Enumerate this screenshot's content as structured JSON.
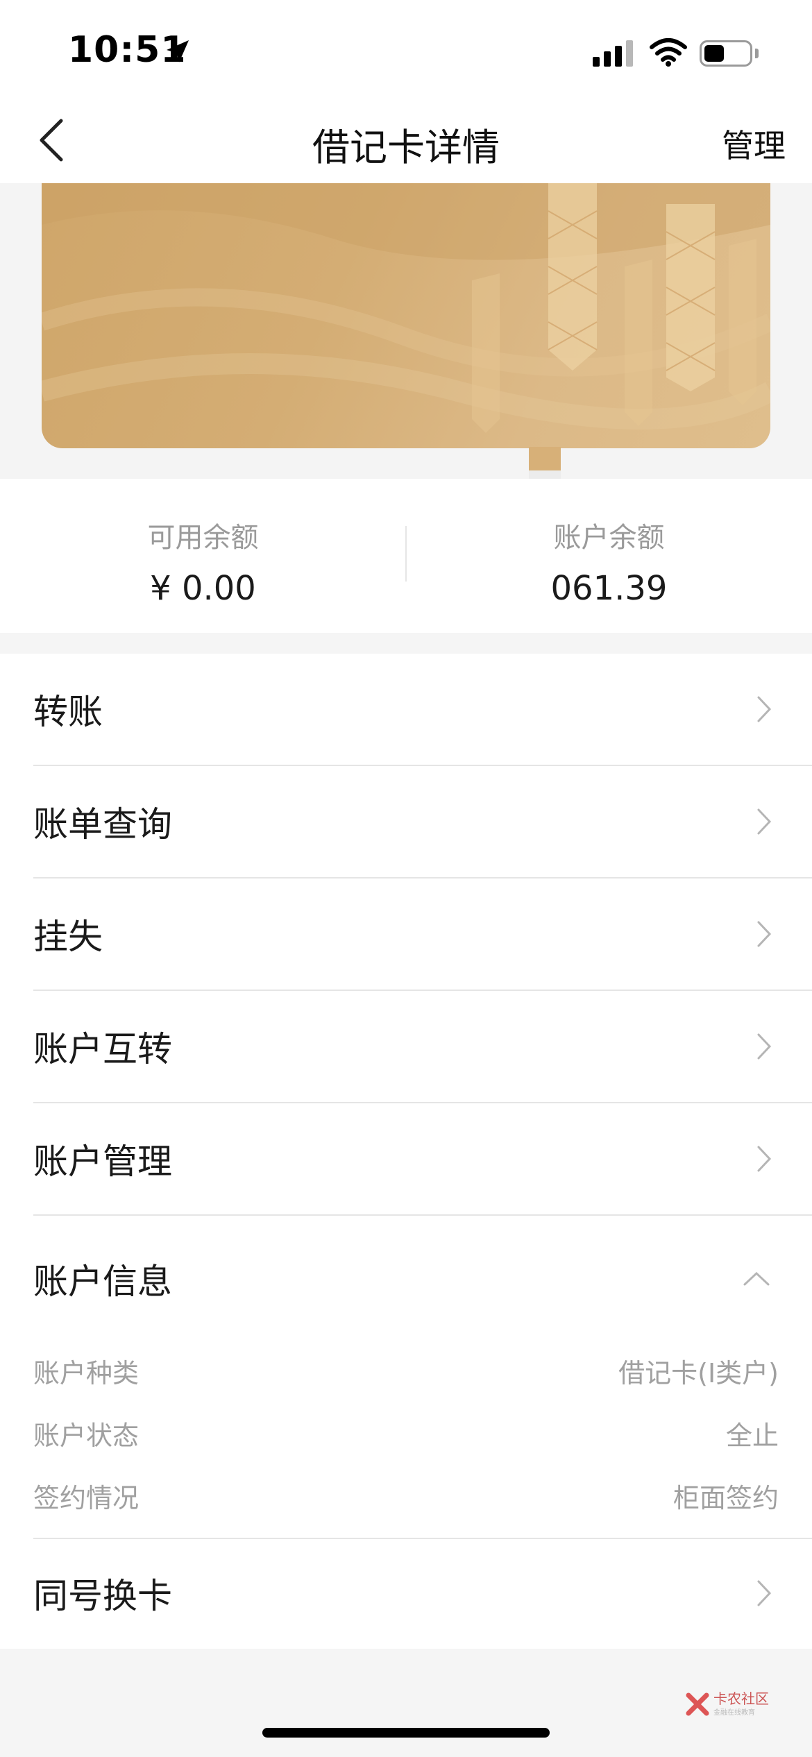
{
  "status_bar": {
    "time": "10:51"
  },
  "nav": {
    "title": "借记卡详情",
    "manage_label": "管理"
  },
  "balances": {
    "available_label": "可用余额",
    "available_value": "¥ 0.00",
    "account_label": "账户余额",
    "account_value": "061.39"
  },
  "menu": {
    "items": [
      {
        "label": "转账"
      },
      {
        "label": "账单查询"
      },
      {
        "label": "挂失"
      },
      {
        "label": "账户互转"
      },
      {
        "label": "账户管理"
      }
    ],
    "account_info": {
      "label": "账户信息",
      "rows": [
        {
          "key": "账户种类",
          "value": "借记卡(I类户)"
        },
        {
          "key": "账户状态",
          "value": "全止"
        },
        {
          "key": "签约情况",
          "value": "柜面签约"
        }
      ]
    },
    "card_replace_label": "同号换卡"
  },
  "watermark": {
    "text": "卡农社区",
    "sub": "金融在线教育"
  },
  "colors": {
    "card_gold": "#d4ad74",
    "text_primary": "#1a1a1a",
    "text_secondary": "#9a9a9a",
    "background": "#f5f5f5"
  }
}
